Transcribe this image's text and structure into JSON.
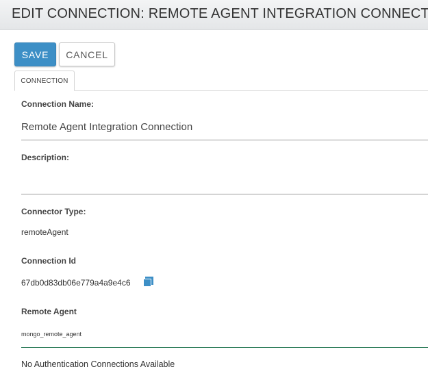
{
  "header": {
    "title": "EDIT CONNECTION: REMOTE AGENT INTEGRATION CONNECTION"
  },
  "toolbar": {
    "save_label": "SAVE",
    "cancel_label": "CANCEL"
  },
  "tabs": [
    {
      "label": "CONNECTION",
      "active": true
    }
  ],
  "form": {
    "connection_name": {
      "label": "Connection Name:",
      "value": "Remote Agent Integration Connection"
    },
    "description": {
      "label": "Description:",
      "value": ""
    },
    "connector_type": {
      "label": "Connector Type:",
      "value": "remoteAgent"
    },
    "connection_id": {
      "label": "Connection Id",
      "value": "67db0d83db06e779a4a9e4c6",
      "copy_icon": "copy-icon"
    },
    "remote_agent": {
      "label": "Remote Agent",
      "value": "mongo_remote_agent"
    },
    "auth_message": "No Authentication Connections Available"
  },
  "colors": {
    "primary": "#3d8fc6",
    "header_bg": "#e9ebed",
    "focus_underline": "#2e7d5b"
  }
}
